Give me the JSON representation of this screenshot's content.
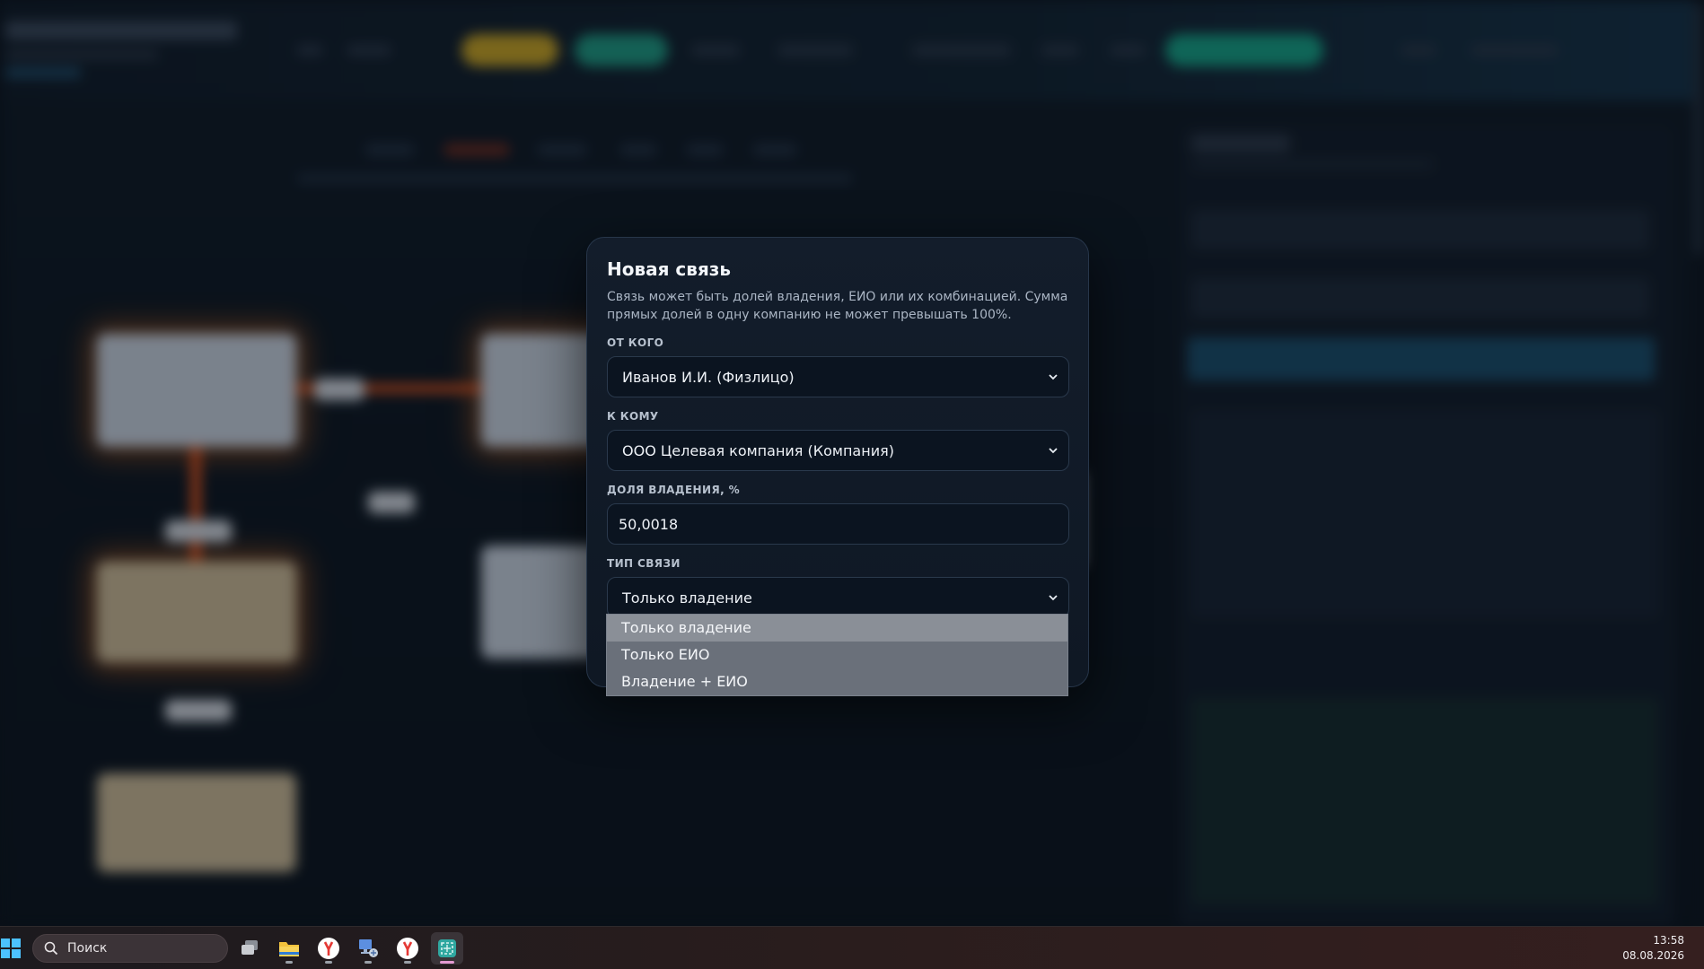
{
  "modal": {
    "title": "Новая связь",
    "description": "Связь может быть долей владения, ЕИО или их комбинацией. Сумма прямых долей в одну компанию не может превышать 100%.",
    "from_label": "ОТ КОГО",
    "from_value": "Иванов И.И. (Физлицо)",
    "to_label": "К КОМУ",
    "to_value": "ООО Целевая компания (Компания)",
    "share_label": "ДОЛЯ ВЛАДЕНИЯ, %",
    "share_value": "50,0018",
    "type_label": "ТИП СВЯЗИ",
    "type_value": "Только владение"
  },
  "dropdown": {
    "options": [
      "Только владение",
      "Только ЕИО",
      "Владение + ЕИО"
    ],
    "selected": "Только владение"
  },
  "taskbar": {
    "search_placeholder": "Поиск",
    "apps": [
      "task-view",
      "file-explorer",
      "yandex-browser",
      "network-app",
      "yandex-browser-2",
      "snipping-tool"
    ],
    "time": "13:58",
    "date": "08.08.2026"
  },
  "colors": {
    "modal_bg": "#131d2b",
    "dropdown_bg": "#6a707a",
    "dropdown_selected": "#8a8f97",
    "edge_orange": "#d8521d"
  }
}
